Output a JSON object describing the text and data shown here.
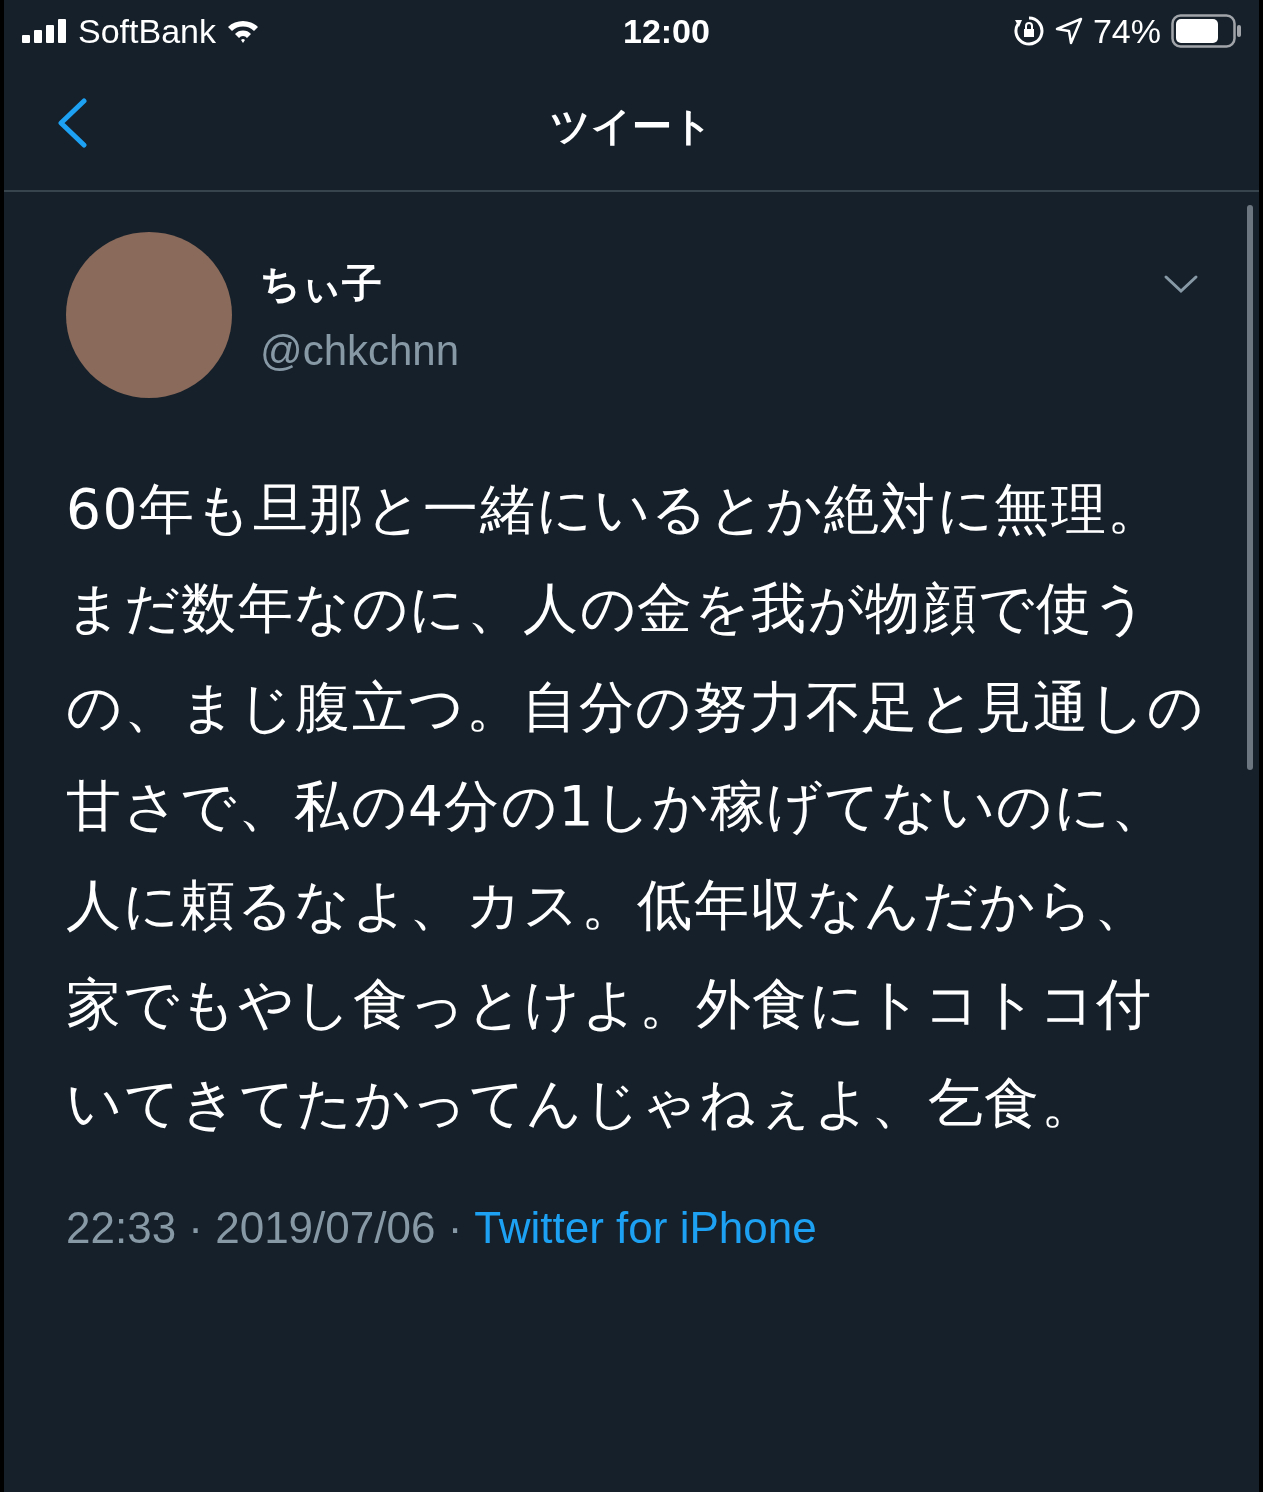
{
  "status_bar": {
    "carrier": "SoftBank",
    "time": "12:00",
    "battery": "74%"
  },
  "nav": {
    "title": "ツイート"
  },
  "tweet": {
    "name": "ちぃ子",
    "handle": "@chkchnn",
    "text": "60年も旦那と一緒にいるとか絶対に無理。まだ数年なのに、人の金を我が物顔で使うの、まじ腹立つ。自分の努力不足と見通しの甘さで、私の4分の1しか稼げてないのに、人に頼るなよ、カス。低年収なんだから、家でもやし食っとけよ。外食にトコトコ付いてきてたかってんじゃねぇよ、乞食。",
    "meta": "22:33 · 2019/07/06 ·",
    "source": "Twitter for iPhone"
  }
}
